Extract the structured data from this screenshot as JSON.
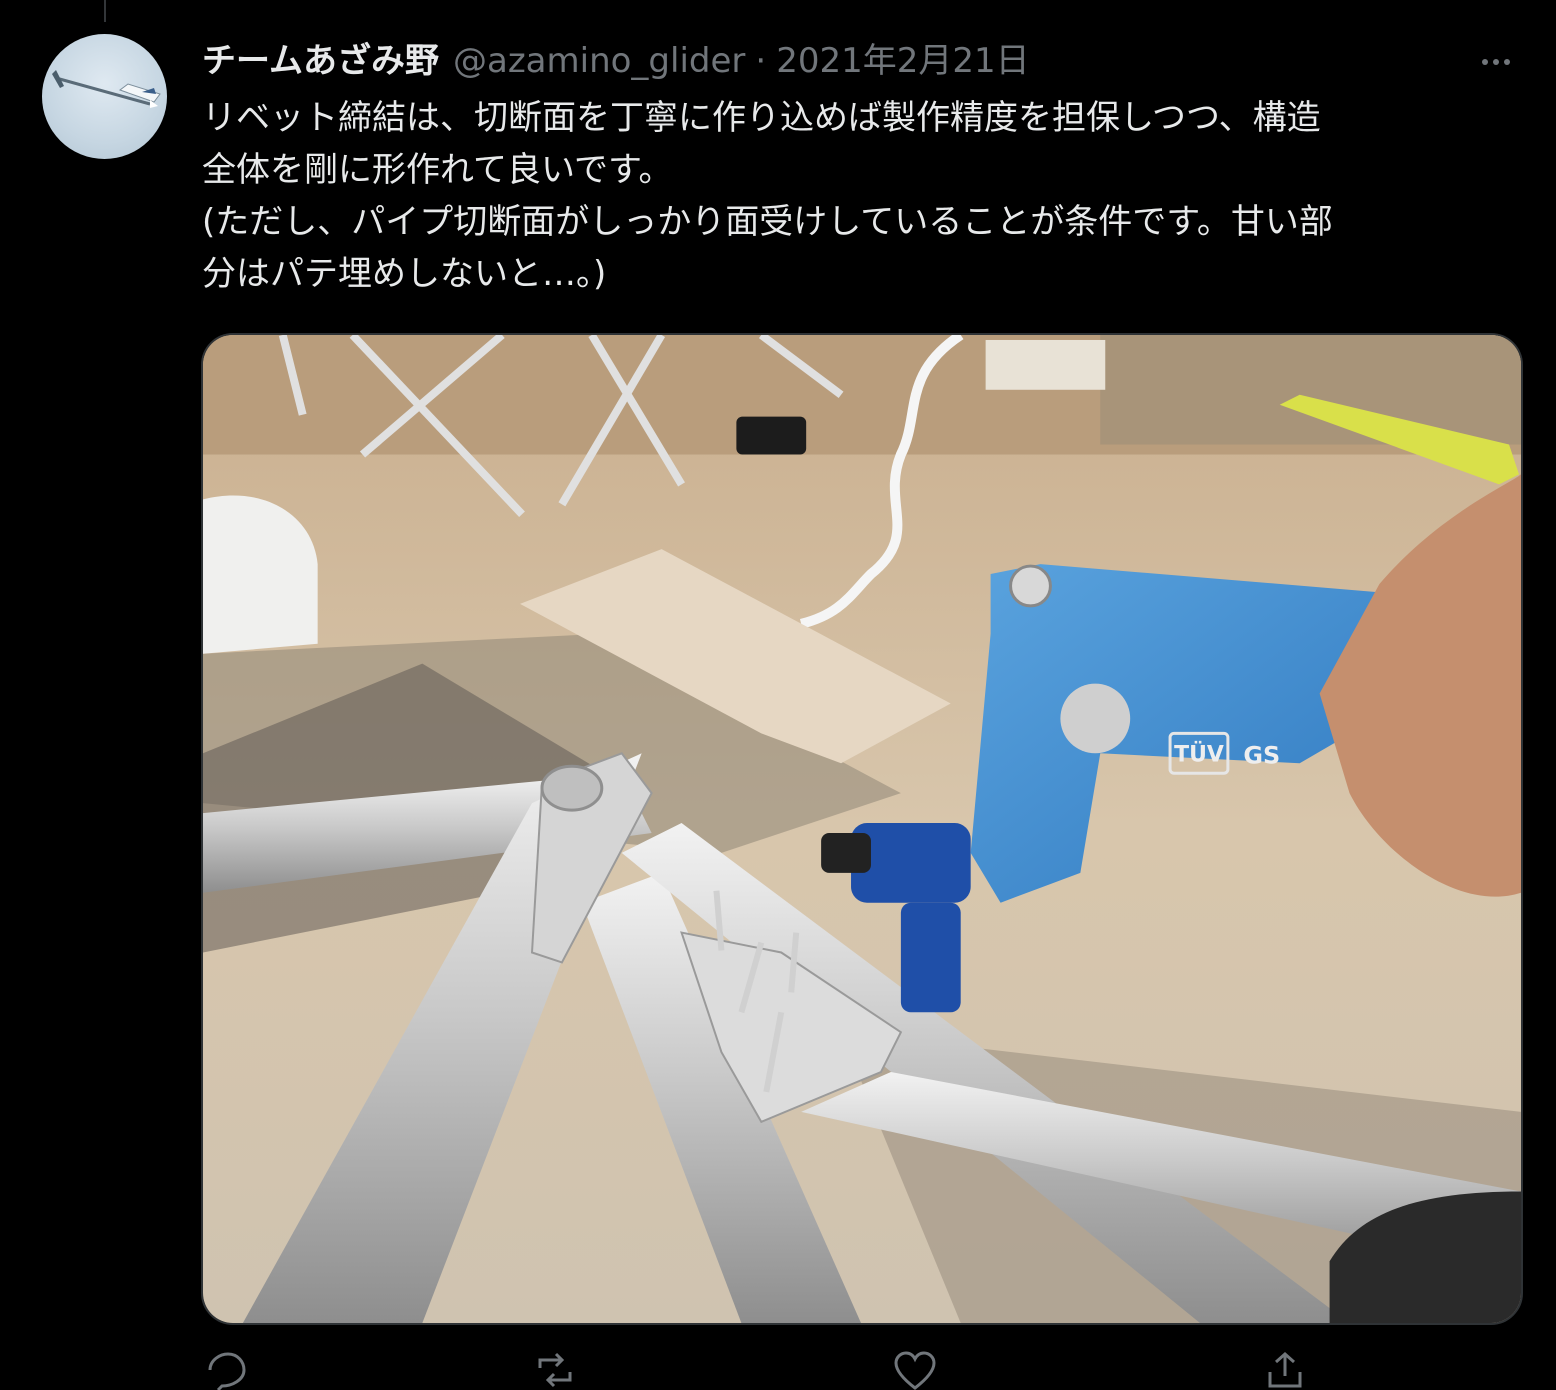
{
  "tweet": {
    "author_name": "チームあざみ野",
    "handle": "@azamino_glider",
    "separator": "·",
    "date": "2021年2月21日",
    "text_lines": [
      "リベット締結は、切断面を丁寧に作り込めば製作精度を担保しつつ、構造",
      "全体を剛に形作れて良いです。",
      "(ただし、パイプ切断面がしっかり面受けしていることが条件です。甘い部",
      "分はパテ埋めしないと…。)"
    ],
    "photo_labels": {
      "tuv": "TÜV",
      "gs": "GS"
    }
  },
  "icons": {
    "more": "more-horizontal-icon",
    "reply": "reply-icon",
    "retweet": "retweet-icon",
    "like": "like-icon",
    "share": "share-icon"
  },
  "colors": {
    "background": "#000000",
    "text": "#e7e9ea",
    "secondary_text": "#71767b",
    "border": "#2f3336"
  }
}
